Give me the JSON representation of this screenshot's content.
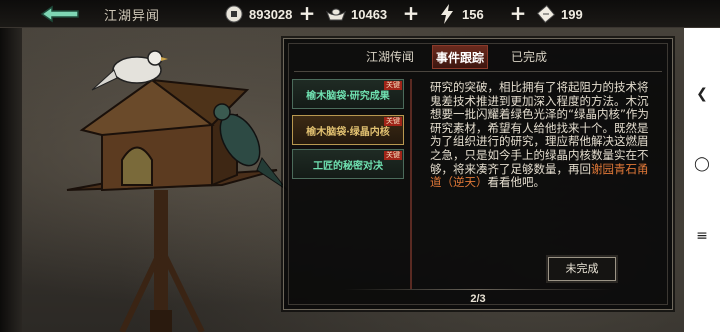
{
  "header": {
    "title": "江湖异闻",
    "resources": [
      {
        "name": "coins",
        "icon": "coin-icon",
        "value": "893028"
      },
      {
        "name": "ingots",
        "icon": "ingot-icon",
        "value": "10463"
      },
      {
        "name": "energy",
        "icon": "lightning-icon",
        "value": "156"
      },
      {
        "name": "tickets",
        "icon": "ticket-icon",
        "value": "199"
      }
    ]
  },
  "tabs": [
    {
      "label": "江湖传闻",
      "active": false
    },
    {
      "label": "事件跟踪",
      "active": true
    },
    {
      "label": "已完成",
      "active": false
    }
  ],
  "quests": [
    {
      "label": "榆木脑袋·研究成果",
      "tag": "关键",
      "selected": false
    },
    {
      "label": "榆木脑袋·绿晶内核",
      "tag": "关键",
      "selected": true
    },
    {
      "label": "工匠的秘密对决",
      "tag": "关键",
      "selected": false
    }
  ],
  "description": {
    "part1": "研究的突破，相比拥有了将起阻力的技术将鬼差技术推进到更加深入程度的方法。木沉想要一批闪耀着绿色光泽的“绿晶内核”作为研究素材，希望有人给他找来十个。既然是为了组织进行的研究，理应帮他解决这燃眉之急，只是如今手上的绿晶内核数量实在不够，将来凑齐了足够数量，再回",
    "location": "谢园青石甬道（逆天）",
    "part2": "看看他吧。"
  },
  "button_unfinished": "未完成",
  "pager": "2/3",
  "colors": {
    "accent": "#e07838",
    "quest_text": "#6fe0b0",
    "tag_red": "#a02418"
  }
}
